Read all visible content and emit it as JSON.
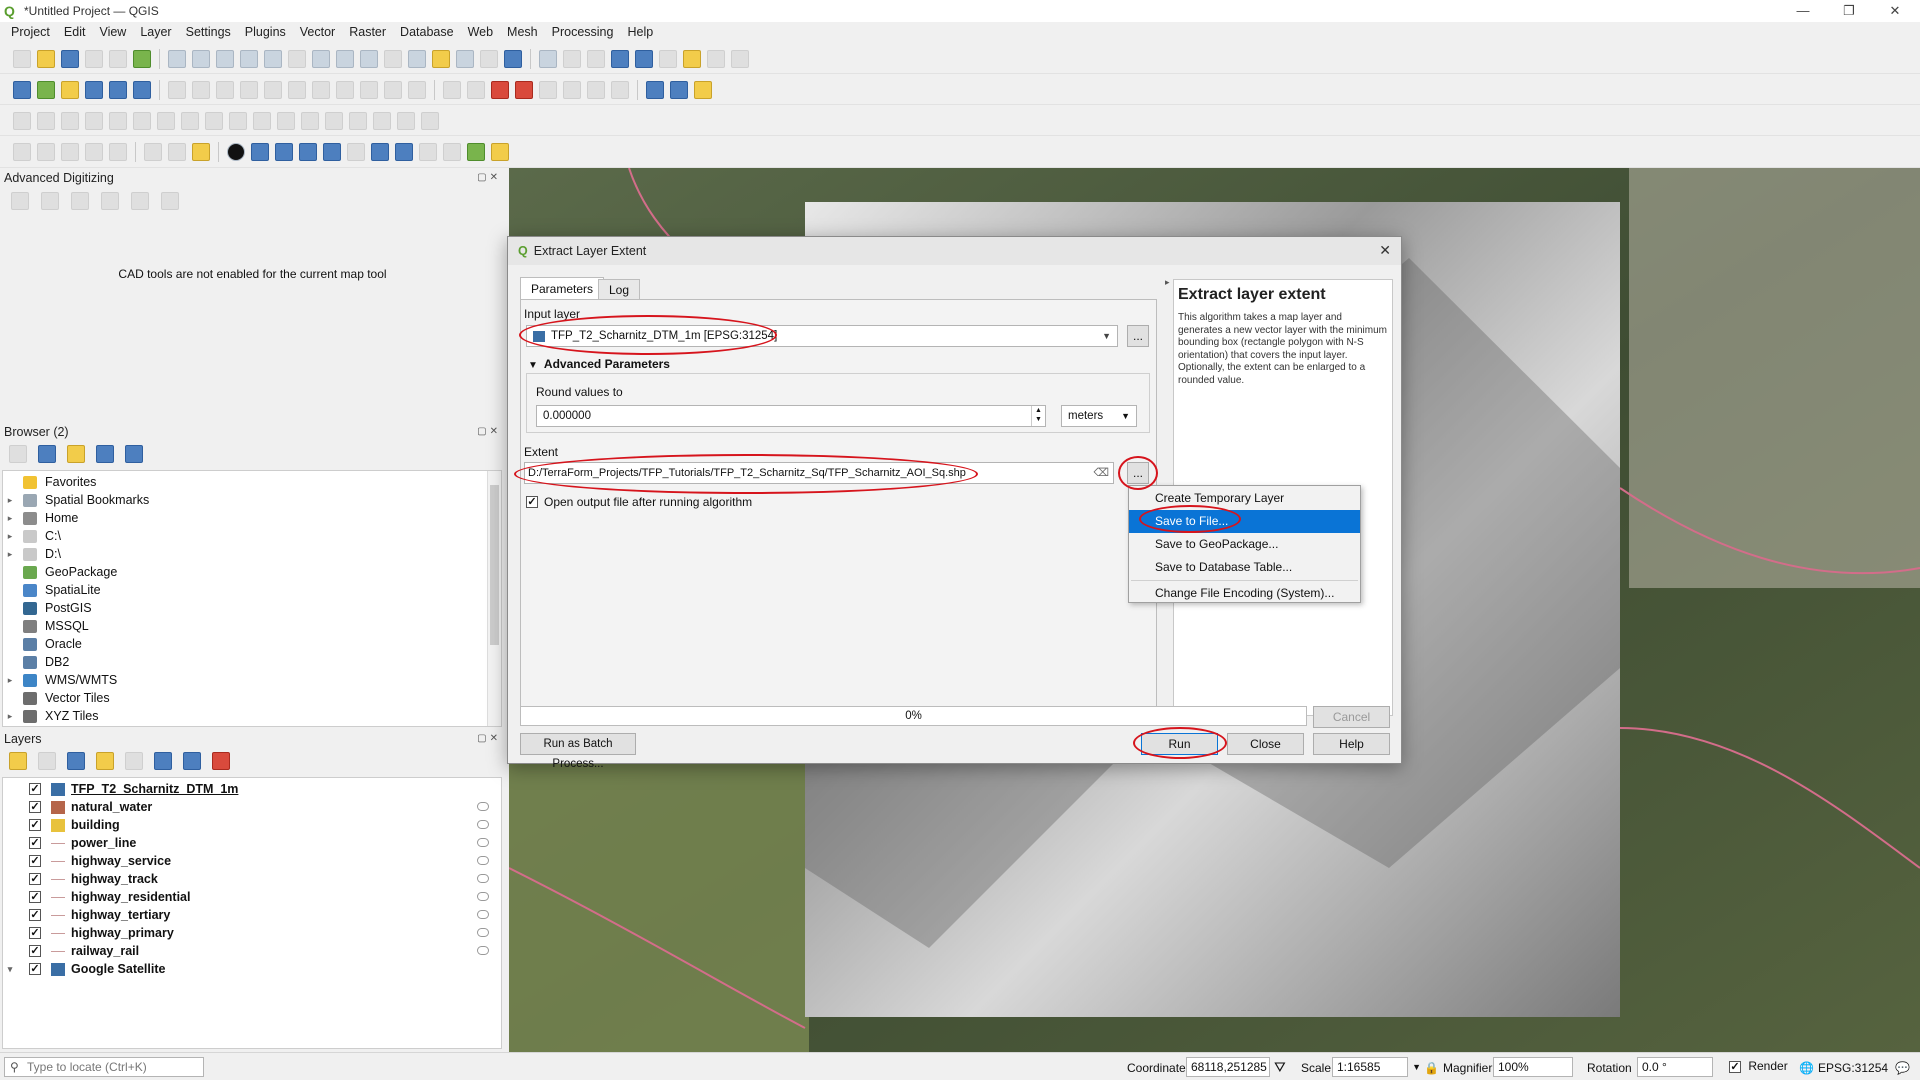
{
  "window": {
    "title": "*Untitled Project — QGIS"
  },
  "menu": [
    "Project",
    "Edit",
    "View",
    "Layer",
    "Settings",
    "Plugins",
    "Vector",
    "Raster",
    "Database",
    "Web",
    "Mesh",
    "Processing",
    "Help"
  ],
  "advanced_digitizing": {
    "title": "Advanced Digitizing",
    "message": "CAD tools are not enabled for the current map tool"
  },
  "browser": {
    "title": "Browser (2)",
    "items": [
      {
        "label": "Favorites",
        "color": "#f1c232",
        "expand": ""
      },
      {
        "label": "Spatial Bookmarks",
        "color": "#9aa7b3",
        "expand": "▸"
      },
      {
        "label": "Home",
        "color": "#8c8c8c",
        "expand": "▸"
      },
      {
        "label": "C:\\",
        "color": "#c9c9c9",
        "expand": "▸"
      },
      {
        "label": "D:\\",
        "color": "#c9c9c9",
        "expand": "▸"
      },
      {
        "label": "GeoPackage",
        "color": "#6aa84f",
        "expand": ""
      },
      {
        "label": "SpatiaLite",
        "color": "#4a86c8",
        "expand": ""
      },
      {
        "label": "PostGIS",
        "color": "#336791",
        "expand": ""
      },
      {
        "label": "MSSQL",
        "color": "#7f7f7f",
        "expand": ""
      },
      {
        "label": "Oracle",
        "color": "#5b7fa6",
        "expand": ""
      },
      {
        "label": "DB2",
        "color": "#5b7fa6",
        "expand": ""
      },
      {
        "label": "WMS/WMTS",
        "color": "#3d85c6",
        "expand": "▸"
      },
      {
        "label": "Vector Tiles",
        "color": "#6d6d6d",
        "expand": ""
      },
      {
        "label": "XYZ Tiles",
        "color": "#6d6d6d",
        "expand": "▸"
      }
    ]
  },
  "layers": {
    "title": "Layers",
    "items": [
      {
        "name": "TFP_T2_Scharnitz_DTM_1m",
        "kind": "raster",
        "color": "#3a6ea5"
      },
      {
        "name": "natural_water",
        "kind": "fill",
        "color": "#b5654a"
      },
      {
        "name": "building",
        "kind": "fill",
        "color": "#e8c23c"
      },
      {
        "name": "power_line",
        "kind": "line",
        "color": "#c99b9b"
      },
      {
        "name": "highway_service",
        "kind": "line",
        "color": "#c99b9b"
      },
      {
        "name": "highway_track",
        "kind": "line",
        "color": "#c99b9b"
      },
      {
        "name": "highway_residential",
        "kind": "line",
        "color": "#c99b9b"
      },
      {
        "name": "highway_tertiary",
        "kind": "line",
        "color": "#c99b9b"
      },
      {
        "name": "highway_primary",
        "kind": "line",
        "color": "#c99b9b"
      },
      {
        "name": "railway_rail",
        "kind": "line",
        "color": "#c99b9b"
      },
      {
        "name": "Google Satellite",
        "kind": "raster",
        "color": "#3a6ea5"
      }
    ]
  },
  "locator": {
    "placeholder": "Type to locate (Ctrl+K)"
  },
  "dialog": {
    "title": "Extract Layer Extent",
    "tabs": [
      "Parameters",
      "Log"
    ],
    "input_layer_label": "Input layer",
    "input_layer_value": "TFP_T2_Scharnitz_DTM_1m [EPSG:31254]",
    "advanced_label": "Advanced Parameters",
    "round_label": "Round values to",
    "round_value": "0.000000",
    "unit_value": "meters",
    "extent_label": "Extent",
    "extent_value": "D:/TerraForm_Projects/TFP_Tutorials/TFP_T2_Scharnitz_Sq/TFP_Scharnitz_AOI_Sq.shp",
    "open_output_label": "Open output file after running algorithm",
    "progress": "0%",
    "cancel": "Cancel",
    "batch": "Run as Batch Process...",
    "run": "Run",
    "close": "Close",
    "help": "Help",
    "ellipsis": "...",
    "help_title": "Extract layer extent",
    "help_text": "This algorithm takes a map layer and generates a new vector layer with the minimum bounding box (rectangle polygon with N-S orientation) that covers the input layer. Optionally, the extent can be enlarged to a rounded value."
  },
  "context_menu": [
    "Create Temporary Layer",
    "Save to File...",
    "Save to GeoPackage...",
    "Save to Database Table...",
    "Change File Encoding (System)..."
  ],
  "status": {
    "coordinate_label": "Coordinate",
    "coordinate_value": "68118,251285",
    "scale_label": "Scale",
    "scale_value": "1:16585",
    "magnifier_label": "Magnifier",
    "magnifier_value": "100%",
    "rotation_label": "Rotation",
    "rotation_value": "0.0 °",
    "render_label": "Render",
    "crs": "EPSG:31254"
  },
  "colors": {
    "accent": "#0a74d6",
    "annotation": "#d6141c"
  }
}
